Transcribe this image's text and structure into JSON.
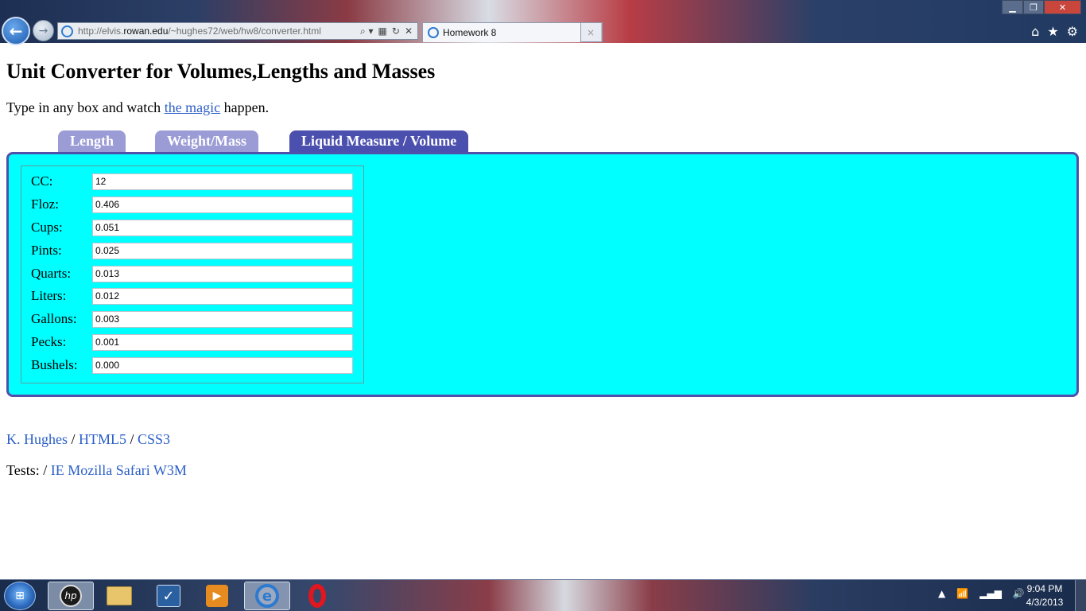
{
  "browser": {
    "url_prefix": "http://elvis.",
    "url_domain": "rowan.edu",
    "url_path": "/~hughes72/web/hw8/converter.html",
    "tab_title": "Homework 8",
    "tab_close": "×",
    "back_glyph": "←",
    "forward_glyph": "→",
    "search_glyph": "⌕ ▾",
    "compat_glyph": "▦",
    "refresh_glyph": "↻",
    "stop_glyph": "✕",
    "home_glyph": "⌂",
    "favorites_glyph": "★",
    "tools_glyph": "⚙",
    "min_glyph": "▁",
    "max_glyph": "❐",
    "close_glyph": "✕"
  },
  "page": {
    "title": "Unit Converter for Volumes,Lengths and Masses",
    "intro_before": "Type in any box and watch ",
    "intro_link": "the magic",
    "intro_after": " happen.",
    "tabs": [
      {
        "label": "Length",
        "active": false
      },
      {
        "label": "Weight/Mass",
        "active": false
      },
      {
        "label": "Liquid Measure / Volume",
        "active": true
      }
    ],
    "fields": [
      {
        "label": "CC:",
        "value": "12"
      },
      {
        "label": "Floz:",
        "value": "0.406"
      },
      {
        "label": "Cups:",
        "value": "0.051"
      },
      {
        "label": "Pints:",
        "value": "0.025"
      },
      {
        "label": "Quarts:",
        "value": "0.013"
      },
      {
        "label": "Liters:",
        "value": "0.012"
      },
      {
        "label": "Gallons:",
        "value": "0.003"
      },
      {
        "label": "Pecks:",
        "value": "0.001"
      },
      {
        "label": "Bushels:",
        "value": "0.000"
      }
    ],
    "footer": {
      "author": "K. Hughes",
      "sep": " / ",
      "html5": "HTML5",
      "css3": "CSS3",
      "tests_label": "Tests: / ",
      "tests_links": "IE Mozilla Safari W3M"
    }
  },
  "taskbar": {
    "start_glyph": "⊞",
    "hp_label": "hp",
    "check_glyph": "✓",
    "media_glyph": "▶",
    "ie_glyph": "e",
    "tray_up": "▲",
    "tray_network": "📶",
    "tray_signal": "▂▄▆",
    "tray_volume": "🔊",
    "time": "9:04 PM",
    "date": "4/3/2013"
  },
  "colors": {
    "panel_bg": "#00ffff",
    "panel_border": "#5050aa",
    "tab_active": "#4b4fae",
    "tab_inactive": "#9b9bd6",
    "link": "#2b5fc8"
  }
}
